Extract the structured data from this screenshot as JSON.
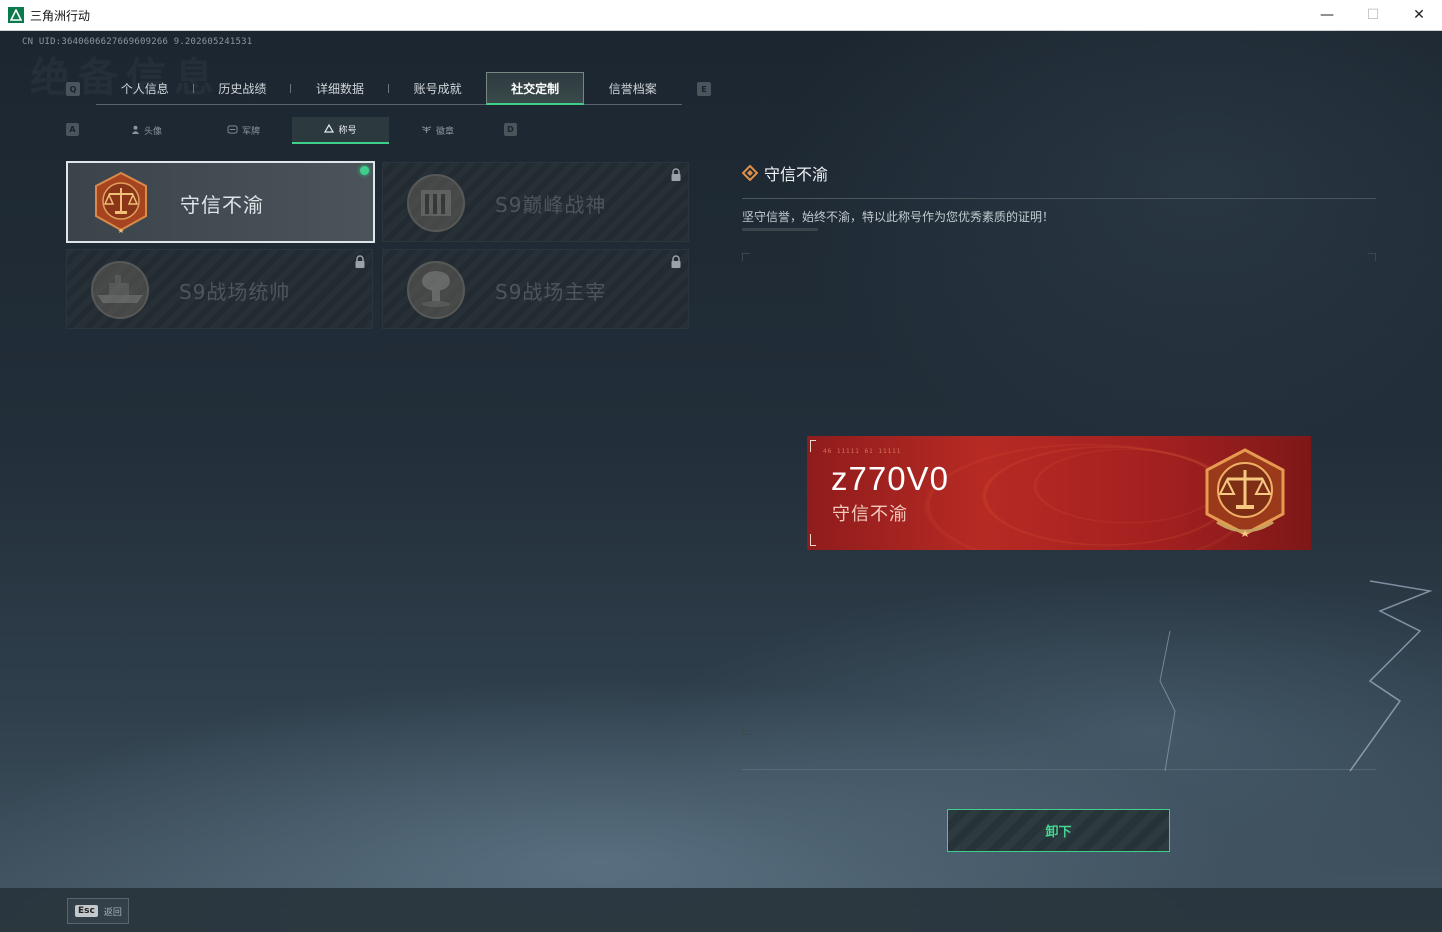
{
  "window": {
    "title": "三角洲行动",
    "minimize_glyph": "—",
    "maximize_glyph": "☐",
    "close_glyph": "✕"
  },
  "uid_text": "CN UID:3640606627669609266 9.202605241531",
  "watermark_text": "绝备信息",
  "main_tabs": {
    "prev_key": "Q",
    "next_key": "E",
    "items": [
      {
        "label": "个人信息"
      },
      {
        "label": "历史战绩"
      },
      {
        "label": "详细数据"
      },
      {
        "label": "账号成就"
      },
      {
        "label": "社交定制",
        "active": true
      },
      {
        "label": "信誉档案"
      }
    ]
  },
  "sub_tabs": {
    "prev_key": "A",
    "next_key": "D",
    "items": [
      {
        "label": "头像",
        "icon": "person-icon"
      },
      {
        "label": "军牌",
        "icon": "dogtag-icon"
      },
      {
        "label": "称号",
        "icon": "triangle-icon",
        "active": true
      },
      {
        "label": "徽章",
        "icon": "wings-icon"
      }
    ]
  },
  "titles": [
    {
      "label": "守信不渝",
      "locked": false,
      "selected": true,
      "equipped": true,
      "badge_icon": "scales-badge-icon"
    },
    {
      "label": "S9巅峰战神",
      "locked": true,
      "selected": false,
      "equipped": false,
      "badge_icon": "fortress-badge-icon"
    },
    {
      "label": "S9战场统帅",
      "locked": true,
      "selected": false,
      "equipped": false,
      "badge_icon": "warship-badge-icon"
    },
    {
      "label": "S9战场主宰",
      "locked": true,
      "selected": false,
      "equipped": false,
      "badge_icon": "explosion-badge-icon"
    }
  ],
  "detail": {
    "title": "守信不渝",
    "description": "坚守信誉，始终不渝，特以此称号作为您优秀素质的证明！"
  },
  "nameplate": {
    "code": "46 11111  61 11111",
    "player_name": "z770V0",
    "title": "守信不渝",
    "color": "#b72a24"
  },
  "actions": {
    "unequip_label": "卸下"
  },
  "footer": {
    "esc_key": "Esc",
    "esc_label": "返回"
  },
  "colors": {
    "accent": "#3ecf8a",
    "badge_bronze": "#c06a2a"
  }
}
